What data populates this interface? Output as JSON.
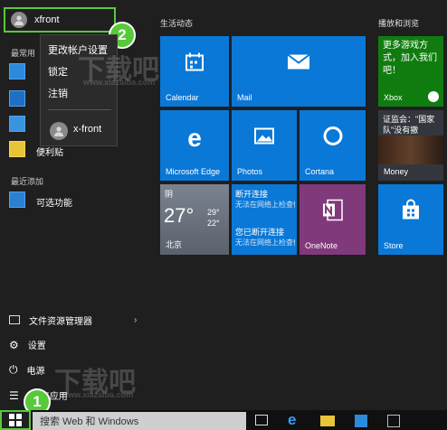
{
  "user": {
    "name": "xfront"
  },
  "left": {
    "most_used_label": "最常用",
    "apps": [
      {
        "label": ""
      },
      {
        "label": ""
      },
      {
        "label": ""
      },
      {
        "label": "便利贴"
      }
    ],
    "recently_added_label": "最近添加",
    "recent_app_label": "可选功能",
    "bottom": {
      "explorer": "文件资源管理器",
      "settings": "设置",
      "power": "电源",
      "all_apps": "所有应用"
    }
  },
  "popup": {
    "change_settings": "更改帐户设置",
    "lock": "锁定",
    "sign_out": "注销",
    "other_user": "x-front"
  },
  "badges": {
    "one": "1",
    "two": "2"
  },
  "groups": {
    "life": "生活动态",
    "play": "播放和浏览"
  },
  "tiles": {
    "calendar": "Calendar",
    "mail": "Mail",
    "edge": "Microsoft Edge",
    "photos": "Photos",
    "cortana": "Cortana",
    "weather": {
      "condition": "阴",
      "temp": "27°",
      "high": "29°",
      "low": "22°",
      "city": "北京"
    },
    "news": {
      "line1": "断开连接",
      "line2": "无法在网络上检查信息",
      "line3": "您已断开连接",
      "line4": "无法在网络上检查信息"
    },
    "onenote": "OneNote",
    "store": "Store",
    "xbox_promo": "更多游戏方式，加入我们吧！",
    "xbox": "Xbox",
    "money_headline": "证监会：\"国家队\"没有撤",
    "money": "Money"
  },
  "taskbar": {
    "search_placeholder": "搜索 Web 和 Windows"
  },
  "watermark": {
    "text1": "下载吧",
    "text2": "www.xiazaiba.com"
  },
  "colors": {
    "tile_blue": "#0a78d7",
    "onenote": "#80397b",
    "xbox": "#107c10",
    "badge_green": "#58c93a"
  }
}
